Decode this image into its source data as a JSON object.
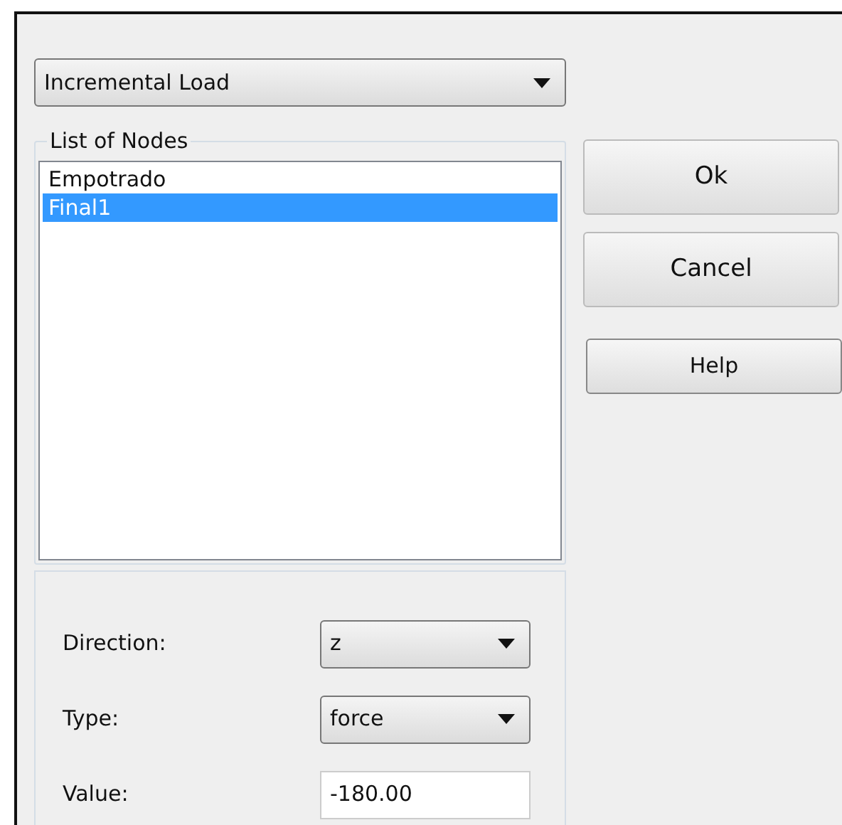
{
  "load_type": {
    "value": "Incremental Load"
  },
  "nodes": {
    "title": "List of Nodes",
    "items": [
      {
        "label": "Empotrado",
        "selected": false
      },
      {
        "label": "Final1",
        "selected": true
      }
    ]
  },
  "fields": [
    {
      "kind": "select",
      "label": "Direction:",
      "value": "z"
    },
    {
      "kind": "select",
      "label": "Type:",
      "value": "force"
    },
    {
      "kind": "input",
      "label": "Value:",
      "value": "-180.00"
    }
  ],
  "buttons": [
    {
      "label": "Ok",
      "kind": "large"
    },
    {
      "label": "Cancel",
      "kind": "large"
    },
    {
      "label": "Help",
      "kind": "small"
    }
  ]
}
